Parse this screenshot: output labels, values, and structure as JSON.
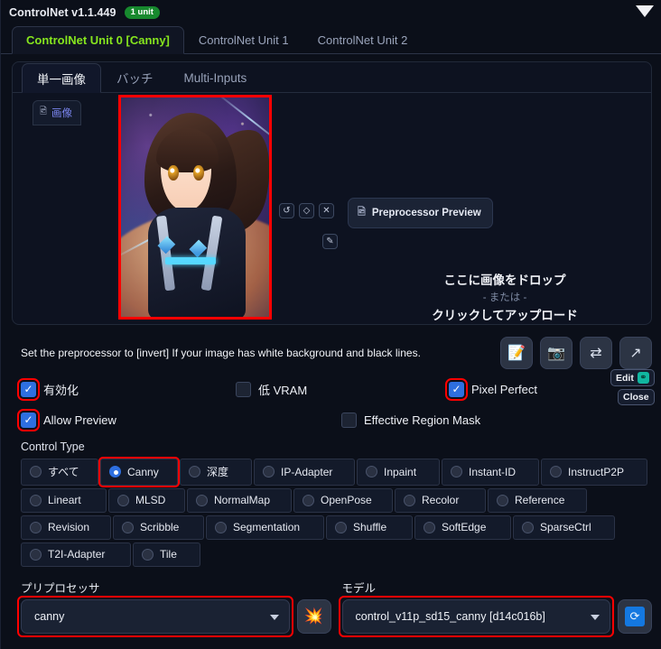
{
  "header": {
    "title": "ControlNet v1.1.449",
    "badge": "1 unit",
    "collapse_icon": "triangle-down-icon"
  },
  "unit_tabs": [
    {
      "label": "ControlNet Unit 0 [Canny]",
      "active": true
    },
    {
      "label": "ControlNet Unit 1",
      "active": false
    },
    {
      "label": "ControlNet Unit 2",
      "active": false
    }
  ],
  "sub_tabs": [
    {
      "label": "単一画像",
      "active": true
    },
    {
      "label": "バッチ",
      "active": false
    },
    {
      "label": "Multi-Inputs",
      "active": false
    }
  ],
  "canvas": {
    "image_chip_label": "画像",
    "image_chip_icon": "image-icon",
    "mini_buttons": [
      {
        "name": "undo-icon",
        "glyph": "↺"
      },
      {
        "name": "eraser-icon",
        "glyph": "◇"
      },
      {
        "name": "remove-icon",
        "glyph": "✕"
      }
    ],
    "draw_button": {
      "name": "pen-icon",
      "glyph": "✎"
    },
    "preprocessor_preview": {
      "label": "Preprocessor Preview",
      "icon": "image-preview-icon"
    },
    "drop_main": "ここに画像をドロップ",
    "drop_or": "- または -",
    "drop_click": "クリックしてアップロード",
    "edit_label": "Edit",
    "edit_icon": "photopea-icon",
    "close_label": "Close"
  },
  "notice": "Set the preprocessor to [invert] If your image has white background and black lines.",
  "tool_buttons": [
    {
      "name": "open-new-canvas-icon",
      "glyph": "📝"
    },
    {
      "name": "webcam-icon",
      "glyph": "📷"
    },
    {
      "name": "swap-icon",
      "glyph": "⇄"
    },
    {
      "name": "send-dimensions-icon",
      "glyph": "↗"
    }
  ],
  "checkbox_rows": [
    [
      {
        "label": "有効化",
        "checked": true,
        "highlight": true
      },
      {
        "label": "低 VRAM",
        "checked": false,
        "highlight": false
      },
      {
        "label": "Pixel Perfect",
        "checked": true,
        "highlight": true
      }
    ],
    [
      {
        "label": "Allow Preview",
        "checked": true,
        "highlight": true
      },
      {
        "label": "Effective Region Mask",
        "checked": false,
        "highlight": false
      }
    ]
  ],
  "control_type": {
    "title": "Control Type",
    "rows": [
      [
        {
          "label": "すべて",
          "selected": false,
          "highlight": false
        },
        {
          "label": "Canny",
          "selected": true,
          "highlight": true
        },
        {
          "label": "深度",
          "selected": false,
          "highlight": false
        },
        {
          "label": "IP-Adapter",
          "selected": false,
          "highlight": false
        },
        {
          "label": "Inpaint",
          "selected": false,
          "highlight": false
        },
        {
          "label": "Instant-ID",
          "selected": false,
          "highlight": false
        },
        {
          "label": "InstructP2P",
          "selected": false,
          "highlight": false
        }
      ],
      [
        {
          "label": "Lineart",
          "selected": false,
          "highlight": false
        },
        {
          "label": "MLSD",
          "selected": false,
          "highlight": false
        },
        {
          "label": "NormalMap",
          "selected": false,
          "highlight": false
        },
        {
          "label": "OpenPose",
          "selected": false,
          "highlight": false
        },
        {
          "label": "Recolor",
          "selected": false,
          "highlight": false
        },
        {
          "label": "Reference",
          "selected": false,
          "highlight": false
        }
      ],
      [
        {
          "label": "Revision",
          "selected": false,
          "highlight": false
        },
        {
          "label": "Scribble",
          "selected": false,
          "highlight": false
        },
        {
          "label": "Segmentation",
          "selected": false,
          "highlight": false
        },
        {
          "label": "Shuffle",
          "selected": false,
          "highlight": false
        },
        {
          "label": "SoftEdge",
          "selected": false,
          "highlight": false
        },
        {
          "label": "SparseCtrl",
          "selected": false,
          "highlight": false
        }
      ],
      [
        {
          "label": "T2I-Adapter",
          "selected": false,
          "highlight": false
        },
        {
          "label": "Tile",
          "selected": false,
          "highlight": false
        }
      ]
    ]
  },
  "preprocessor": {
    "label": "プリプロセッサ",
    "value": "canny",
    "button_icon": "explosion-icon",
    "button_glyph": "💥"
  },
  "model": {
    "label": "モデル",
    "value": "control_v11p_sd15_canny [d14c016b]",
    "button_icon": "refresh-icon",
    "button_glyph": "⟳"
  },
  "colors": {
    "accent_green": "#86e51e",
    "badge_green": "#17892e",
    "highlight_red": "#ff0000",
    "checkbox_blue": "#2e6fe0",
    "background": "#0b0f19"
  }
}
